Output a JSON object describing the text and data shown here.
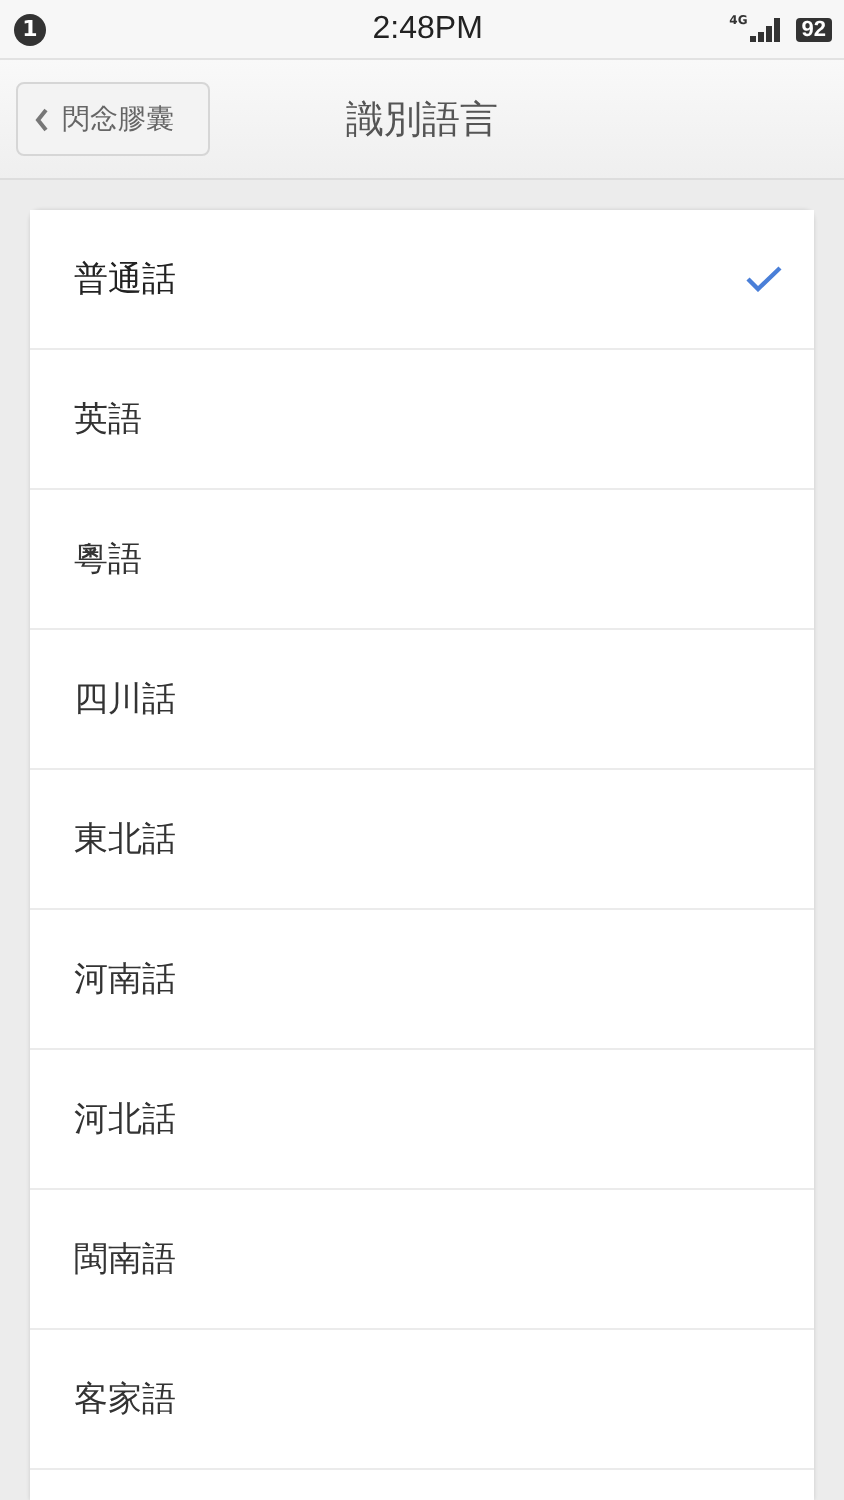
{
  "status_bar": {
    "notification_count": "1",
    "time": "2:48PM",
    "network": "4G",
    "battery": "92"
  },
  "header": {
    "back_label": "閃念膠囊",
    "title": "識別語言"
  },
  "languages": [
    {
      "label": "普通話",
      "selected": true
    },
    {
      "label": "英語",
      "selected": false
    },
    {
      "label": "粵語",
      "selected": false
    },
    {
      "label": "四川話",
      "selected": false
    },
    {
      "label": "東北話",
      "selected": false
    },
    {
      "label": "河南話",
      "selected": false
    },
    {
      "label": "河北話",
      "selected": false
    },
    {
      "label": "閩南語",
      "selected": false
    },
    {
      "label": "客家語",
      "selected": false
    }
  ]
}
